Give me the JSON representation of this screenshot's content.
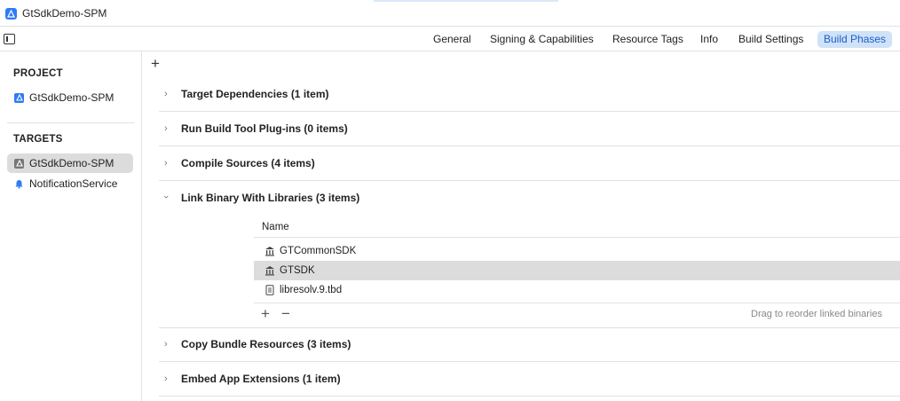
{
  "window": {
    "title": "GtSdkDemo-SPM"
  },
  "tabs": [
    {
      "label": "General"
    },
    {
      "label": "Signing & Capabilities"
    },
    {
      "label": "Resource Tags"
    },
    {
      "label": "Info"
    },
    {
      "label": "Build Settings"
    },
    {
      "label": "Build Phases",
      "active": true
    }
  ],
  "sidebar": {
    "project_header": "PROJECT",
    "project_item": "GtSdkDemo-SPM",
    "targets_header": "TARGETS",
    "targets": [
      {
        "label": "GtSdkDemo-SPM",
        "selected": true,
        "icon": "app-target-icon"
      },
      {
        "label": "NotificationService",
        "icon": "bell-icon"
      }
    ]
  },
  "main": {
    "add_label": "+",
    "phases": [
      {
        "title": "Target Dependencies (1 item)",
        "expanded": false
      },
      {
        "title": "Run Build Tool Plug-ins (0 items)",
        "expanded": false
      },
      {
        "title": "Compile Sources (4 items)",
        "expanded": false
      },
      {
        "title": "Link Binary With Libraries (3 items)",
        "expanded": true
      },
      {
        "title": "Copy Bundle Resources (3 items)",
        "expanded": false
      },
      {
        "title": "Embed App Extensions (1 item)",
        "expanded": false
      }
    ],
    "libraries": {
      "column_name": "Name",
      "rows": [
        {
          "name": "GTCommonSDK",
          "icon": "framework-icon"
        },
        {
          "name": "GTSDK",
          "icon": "framework-icon",
          "selected": true
        },
        {
          "name": "libresolv.9.tbd",
          "icon": "file-icon"
        }
      ],
      "add_label": "+",
      "remove_label": "−",
      "hint": "Drag to reorder linked binaries"
    }
  },
  "colors": {
    "accent": "#2f7bf5",
    "active_tab_bg": "#cfe2f8",
    "active_tab_text": "#1a5fc9",
    "selection": "#dcdcdc"
  }
}
